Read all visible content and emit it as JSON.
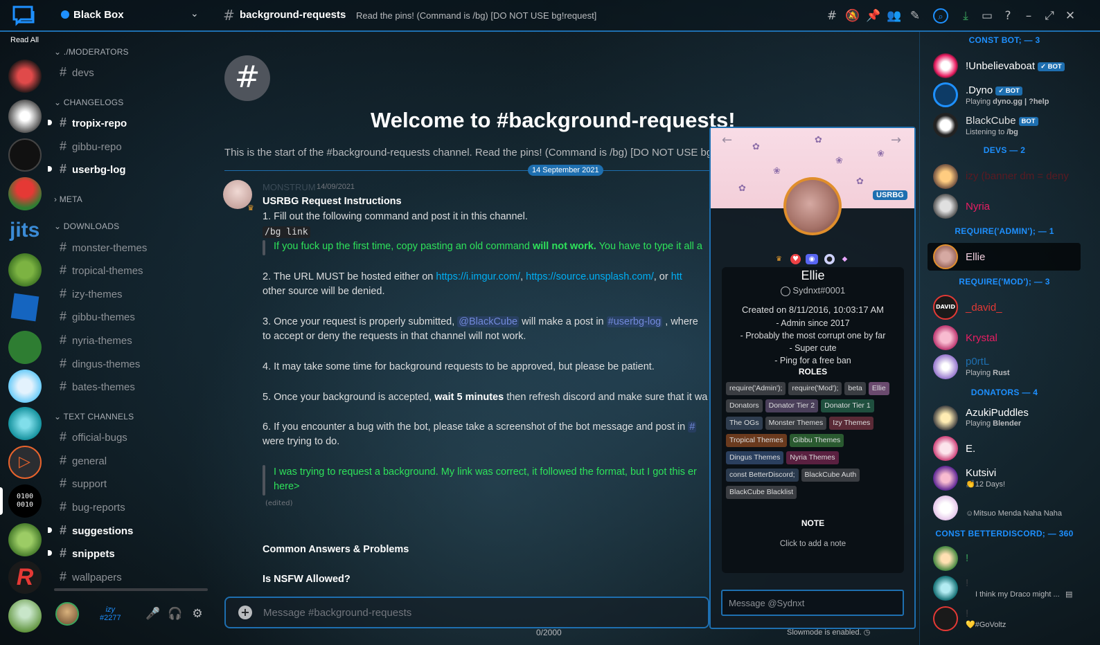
{
  "server": {
    "name": "Black Box",
    "read_all": "Read All"
  },
  "header": {
    "channel": "background-requests",
    "topic": "Read the pins! (Command is /bg) [DO NOT USE bg!request]"
  },
  "categories": [
    {
      "label": "./MODERATORS",
      "channels": [
        "devs"
      ]
    },
    {
      "label": "CHANGELOGS",
      "channels": [
        "tropix-repo",
        "gibbu-repo",
        "userbg-log"
      ]
    },
    {
      "label": "META",
      "channels": []
    },
    {
      "label": "DOWNLOADS",
      "channels": [
        "monster-themes",
        "tropical-themes",
        "izy-themes",
        "gibbu-themes",
        "nyria-themes",
        "dingus-themes",
        "bates-themes"
      ]
    },
    {
      "label": "TEXT CHANNELS",
      "channels": [
        "official-bugs",
        "general",
        "support",
        "bug-reports",
        "suggestions",
        "snippets",
        "wallpapers"
      ]
    }
  ],
  "user": {
    "tag": "#2277",
    "name": "izy"
  },
  "welcome": {
    "title": "Welcome to #background-requests!",
    "subtitle": "This is the start of the #background-requests channel. Read the pins! (Command is /bg) [DO NOT USE bg!request]",
    "date": "14 September 2021"
  },
  "message": {
    "author": "MONSTRUM",
    "timestamp": "14/09/2021",
    "heading": "USRBG Request Instructions",
    "l1": "1. Fill out the following command and post it in this channel.",
    "code": "/bg link",
    "q1a": "If you fuck up the first time, copy pasting an old command ",
    "q1b": "will not work.",
    "q1c": " You have to type it all a",
    "l2a": "2. The URL MUST be hosted either on ",
    "l2link1": "https://i.imgur.com/",
    "l2sep": ", ",
    "l2link2": "https://source.unsplash.com/",
    "l2b": ", or ",
    "l2link3": "htt",
    "l2c": "other source will be denied.",
    "l3a": "3. Once your request is properly submitted, ",
    "l3m": "@BlackCube",
    "l3b": " will make a post in ",
    "l3c": "#userbg-log",
    "l3d": " , where",
    "l3e": "to accept or deny the requests in that channel will not work.",
    "l4": "4. It may take some time for background requests to be approved, but please be patient.",
    "l5a": "5. Once your background is accepted, ",
    "l5b": "wait 5 minutes",
    "l5c": " then refresh discord and make sure that it wa",
    "l6a": "6. If you encounter a bug with the bot, please take a screenshot of the bot message and post in ",
    "l6b": "#",
    "l6c": "were trying to do.",
    "q2a": "I was trying to request a background. My link was correct, it followed the format, but I got this er",
    "q2b": "here>",
    "edited": "(edited)",
    "h2": "Common Answers & Problems",
    "h3": "Is NSFW Allowed?"
  },
  "composer": {
    "placeholder": "Message #background-requests",
    "counter": "0/2000",
    "slowmode": "Slowmode is enabled."
  },
  "profile": {
    "tag_label": "USRBG",
    "name": "Ellie",
    "tag": "Sydnxt#0001",
    "created": "Created on 8/11/2016, 10:03:17 AM",
    "bio": [
      "- Admin since 2017",
      "- Probably the most corrupt one by far",
      "- Super cute",
      "- Ping for a free ban"
    ],
    "roles_label": "ROLES",
    "roles": [
      {
        "name": "require('Admin');",
        "color": "#3a3d42"
      },
      {
        "name": "require('Mod');",
        "color": "#3a3d42"
      },
      {
        "name": "beta",
        "color": "#3a3d42"
      },
      {
        "name": "Ellie",
        "color": "#6a4a6e"
      },
      {
        "name": "Donators",
        "color": "#3a3d42"
      },
      {
        "name": "Donator Tier 2",
        "color": "#4a3f5a"
      },
      {
        "name": "Donator Tier 1",
        "color": "#1f4f3e"
      },
      {
        "name": "The OGs",
        "color": "#2f3d4f"
      },
      {
        "name": "Monster Themes",
        "color": "#3a3d42"
      },
      {
        "name": "Izy Themes",
        "color": "#5a2a36"
      },
      {
        "name": "Tropical Themes",
        "color": "#6a3a1e"
      },
      {
        "name": "Gibbu Themes",
        "color": "#2a5a30"
      },
      {
        "name": "Dingus Themes",
        "color": "#2a3f5e"
      },
      {
        "name": "Nyria Themes",
        "color": "#5a2040"
      },
      {
        "name": "const BetterDiscord;",
        "color": "#2a3a4e"
      },
      {
        "name": "BlackCube Auth",
        "color": "#3a3d42"
      },
      {
        "name": "BlackCube Blacklist",
        "color": "#3a3d42"
      }
    ],
    "note_label": "NOTE",
    "note_hint": "Click to add a note",
    "message_placeholder": "Message @Sydnxt"
  },
  "members": {
    "cat_bots": "CONST BOT; — 3",
    "m1": "!Unbelievaboat",
    "m1b": "✓ BOT",
    "m2": ".Dyno",
    "m2b": "✓ BOT",
    "m2s1": "Playing ",
    "m2s2": "dyno.gg | ?help",
    "m3": "BlackCube",
    "m3b": "BOT",
    "m3s1": "Listening to ",
    "m3s2": "/bg",
    "cat_devs": "DEVS — 2",
    "m4": "izy (banner dm = deny",
    "m5": "Nyria",
    "cat_admin": "REQUIRE('ADMIN'); — 1",
    "m6": "Ellie",
    "cat_mod": "REQUIRE('MOD'); — 3",
    "m7": "_david_",
    "m8": "Krystal",
    "m9": "p0rtL",
    "m9s1": "Playing ",
    "m9s2": "Rust",
    "cat_donators": "DONATORS — 4",
    "m10": "AzukiPuddles",
    "m10s1": "Playing ",
    "m10s2": "Blender",
    "m11": "E.",
    "m12": "Kutsivi",
    "m12s": "👏12 Days!",
    "m13s": "☺Mitsuo Menda Naha Naha",
    "cat_bd": "CONST BETTERDISCORD; — 360",
    "m14": "!",
    "m15": "!",
    "m15s": "I think my Draco might ...",
    "m16": "!",
    "m16s": "💛#GoVoltz"
  }
}
